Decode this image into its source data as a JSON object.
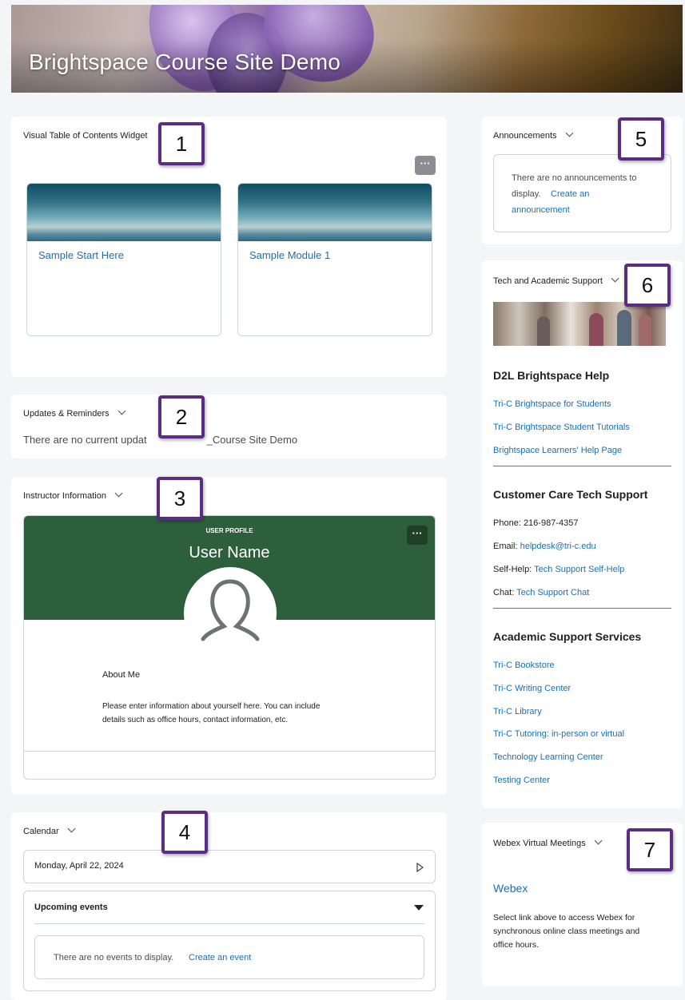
{
  "course_title": "Brightspace Course Site Demo",
  "markers": [
    "1",
    "2",
    "3",
    "4",
    "5",
    "6",
    "7"
  ],
  "vtoc": {
    "title": "Visual Table of Contents Widget",
    "more": "···",
    "tiles": [
      {
        "label": "Sample Start Here"
      },
      {
        "label": "Sample Module 1"
      }
    ]
  },
  "updates": {
    "title": "Updates & Reminders",
    "message_pre": "There are no current updat",
    "message_post": "_Course Site Demo"
  },
  "instructor": {
    "title": "Instructor Information",
    "profile_caption": "USER PROFILE",
    "user_name": "User Name",
    "more": "···",
    "about_heading": "About Me",
    "about_text_line1": "Please enter information about yourself here. You can include",
    "about_text_line2": "details such as office hours, contact information, etc."
  },
  "calendar": {
    "title": "Calendar",
    "date": "Monday, April 22, 2024",
    "upcoming": "Upcoming events",
    "empty": "There are no events to display.",
    "create_link": "Create an event"
  },
  "announcements": {
    "title": "Announcements",
    "empty_line1": "There are no announcements to",
    "empty_line2": "display.",
    "create_link_1": "Create an",
    "create_link_2": "announcement"
  },
  "support": {
    "title": "Tech and Academic Support",
    "help_heading": "D2L Brightspace Help",
    "help_links": [
      "Tri-C Brightspace for Students",
      "Tri-C Brightspace Student Tutorials",
      "Brightspace Learners' Help Page"
    ],
    "care_heading": "Customer Care Tech Support",
    "phone_label": "Phone:",
    "phone": "216-987-4357",
    "email_label": "Email:",
    "email": "helpdesk@tri-c.edu",
    "selfhelp_label": "Self-Help:",
    "selfhelp": "Tech Support Self-Help",
    "chat_label": "Chat:",
    "chat": "Tech Support Chat",
    "academic_heading": "Academic Support Services",
    "academic_links": [
      "Tri-C Bookstore",
      "Tri-C Writing Center",
      "Tri-C Library",
      "Tri-C Tutoring: in-person or virtual",
      "Technology Learning Center",
      "Testing Center"
    ]
  },
  "webex": {
    "title": "Webex Virtual Meetings",
    "link": "Webex",
    "desc_line1": "Select link  above to access Webex for",
    "desc_line2": "synchronous online class meetings and",
    "desc_line3": "office hours."
  }
}
